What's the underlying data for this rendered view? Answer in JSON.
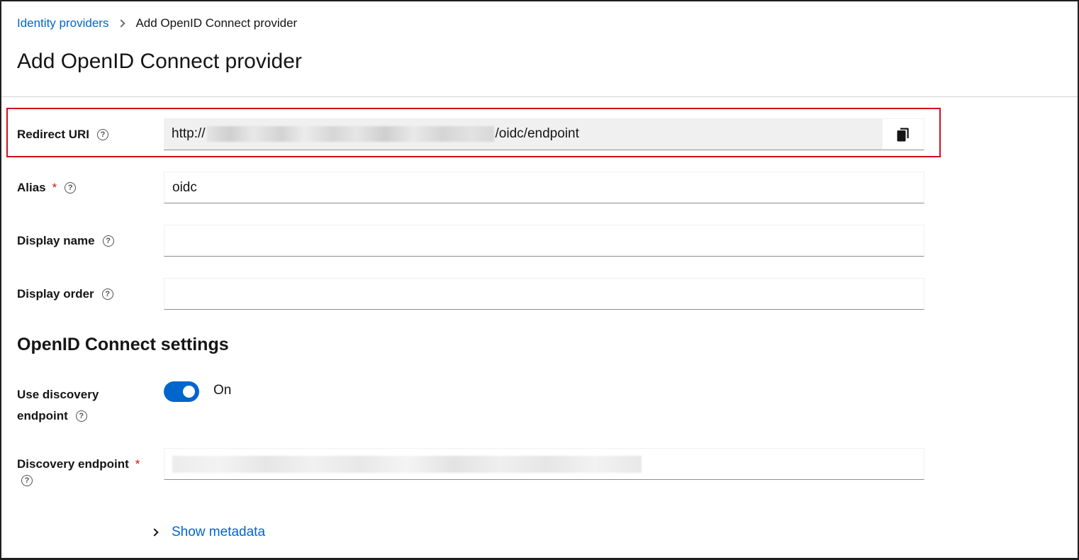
{
  "breadcrumb": {
    "parent": "Identity providers",
    "current": "Add OpenID Connect provider"
  },
  "page_title": "Add OpenID Connect provider",
  "fields": {
    "redirect_uri": {
      "label": "Redirect URI",
      "value_prefix": "http://",
      "value_suffix": "/oidc/endpoint"
    },
    "alias": {
      "label": "Alias",
      "required": "*",
      "value": "oidc"
    },
    "display_name": {
      "label": "Display name",
      "value": ""
    },
    "display_order": {
      "label": "Display order",
      "value": ""
    }
  },
  "oidc_settings": {
    "title": "OpenID Connect settings",
    "use_discovery": {
      "label_line1": "Use discovery",
      "label_line2": "endpoint",
      "toggle_text": "On"
    },
    "discovery_endpoint": {
      "label": "Discovery endpoint",
      "required": "*"
    }
  },
  "show_metadata": "Show metadata",
  "colors": {
    "link": "#0066cc",
    "required": "#c9190b",
    "highlight": "#d0101e",
    "toggle_on": "#0066cc"
  }
}
